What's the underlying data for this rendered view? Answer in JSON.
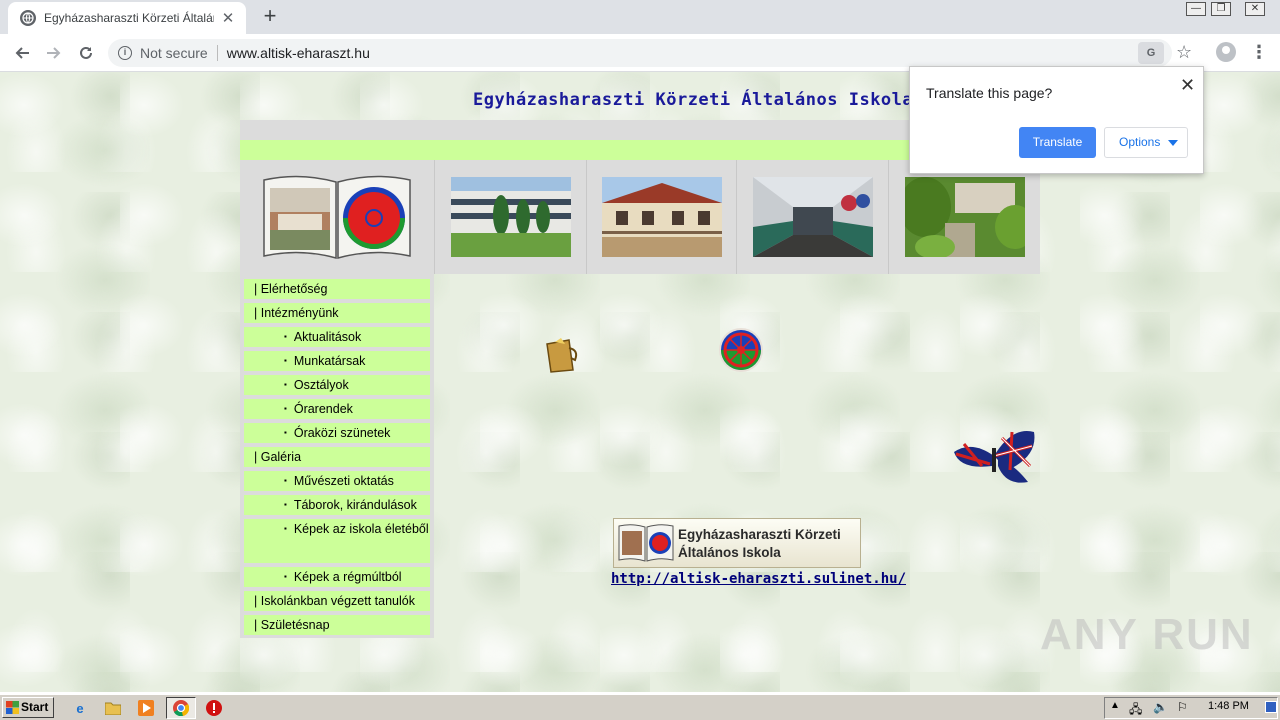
{
  "browser": {
    "tab_title": "Egyházasharaszti Körzeti Általános I",
    "new_tab_symbol": "+",
    "not_secure_label": "Not secure",
    "url": "www.altisk-eharaszt.hu"
  },
  "page": {
    "site_title": "Egyházasharaszti Körzeti Általános Iskola",
    "menu": [
      {
        "label": "| Elérhetőség",
        "level": 0
      },
      {
        "label": "| Intézményünk",
        "level": 0
      },
      {
        "label": "Aktualitások",
        "level": 1
      },
      {
        "label": "Munkatársak",
        "level": 1
      },
      {
        "label": "Osztályok",
        "level": 1
      },
      {
        "label": "Órarendek",
        "level": 1
      },
      {
        "label": "Óraközi szünetek",
        "level": 1
      },
      {
        "label": "| Galéria",
        "level": 0
      },
      {
        "label": "Művészeti oktatás",
        "level": 1
      },
      {
        "label": "Táborok, kirándulások",
        "level": 1
      },
      {
        "label": "Képek az iskola életéből",
        "level": 1
      },
      {
        "label": "Képek a régmúltból",
        "level": 1
      },
      {
        "label": "| Iskolánkban végzett tanulók",
        "level": 0
      },
      {
        "label": "| Születésnap",
        "level": 0
      }
    ],
    "banner_line1": "Egyházasharaszti Körzeti",
    "banner_line2": "Általános Iskola",
    "link_text": "http://altisk-eharaszti.sulinet.hu/",
    "watermark": "ANY RUN"
  },
  "translate_popup": {
    "title": "Translate this page?",
    "translate_button": "Translate",
    "options_button": "Options"
  },
  "taskbar": {
    "start_label": "Start",
    "clock": "1:48 PM"
  },
  "colors": {
    "menu_green": "#ccff99",
    "frame_grey": "#dcdcdc",
    "title_blue": "#1a1a9a",
    "translate_blue": "#4285f4"
  }
}
